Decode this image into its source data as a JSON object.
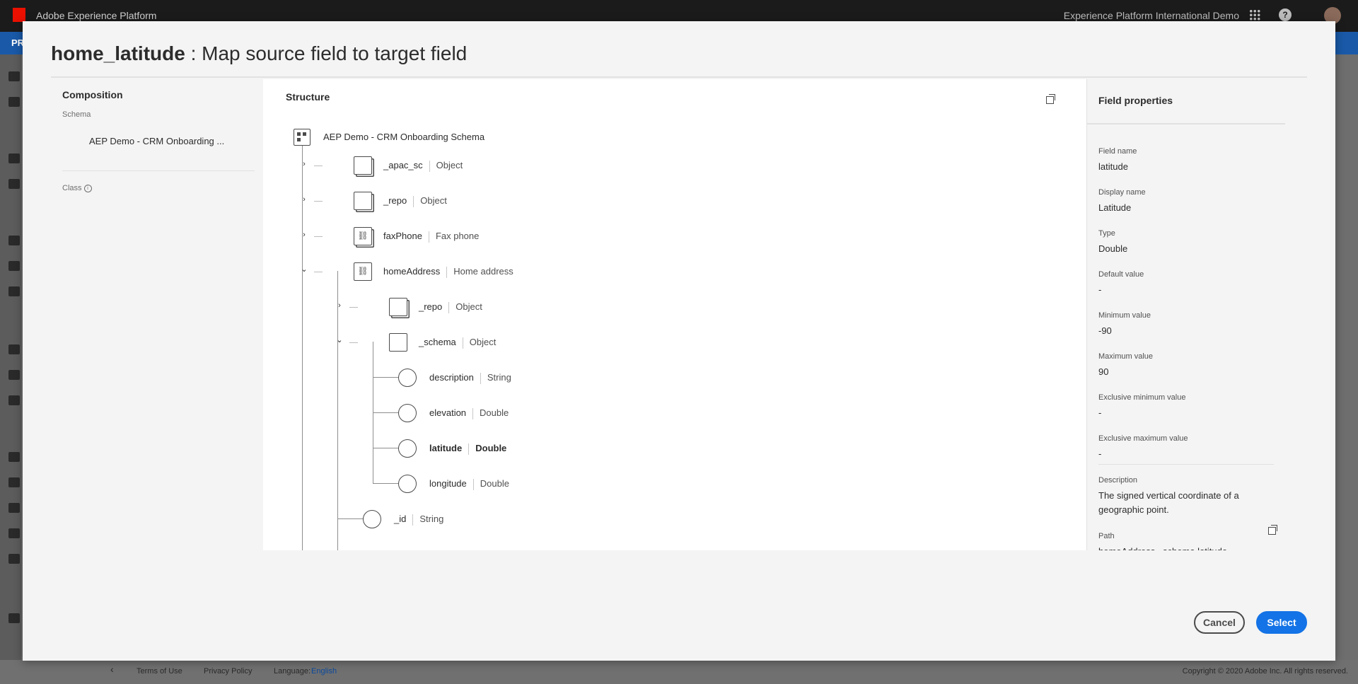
{
  "app": {
    "title": "Adobe Experience Platform",
    "org_name": "Experience Platform International Demo",
    "subnav_label": "PR"
  },
  "footer": {
    "terms": "Terms of Use",
    "privacy": "Privacy Policy",
    "language_label": "Language:",
    "language_value": "English",
    "copyright": "Copyright  ©  2020 Adobe Inc.  All rights reserved."
  },
  "modal": {
    "field_id": "home_latitude",
    "title_sep": " : ",
    "title_text": "Map source field to target field"
  },
  "composition": {
    "heading": "Composition",
    "schema_label": "Schema",
    "schema_name": "AEP Demo - CRM Onboarding ...",
    "class_label": "Class"
  },
  "structure": {
    "heading": "Structure",
    "root": "AEP Demo - CRM Onboarding Schema",
    "rows": [
      {
        "name": "_apac_sc",
        "type": "Object"
      },
      {
        "name": "_repo",
        "type": "Object"
      },
      {
        "name": "faxPhone",
        "type": "Fax phone"
      },
      {
        "name": "homeAddress",
        "type": "Home address"
      },
      {
        "name": "_repo",
        "type": "Object"
      },
      {
        "name": "_schema",
        "type": "Object"
      },
      {
        "name": "description",
        "type": "String"
      },
      {
        "name": "elevation",
        "type": "Double"
      },
      {
        "name": "latitude",
        "type": "Double"
      },
      {
        "name": "longitude",
        "type": "Double"
      },
      {
        "name": "_id",
        "type": "String"
      }
    ]
  },
  "field_properties": {
    "heading": "Field properties",
    "items": [
      {
        "label": "Field name",
        "value": "latitude"
      },
      {
        "label": "Display name",
        "value": "Latitude"
      },
      {
        "label": "Type",
        "value": "Double"
      },
      {
        "label": "Default value",
        "value": "-"
      },
      {
        "label": "Minimum value",
        "value": "-90"
      },
      {
        "label": "Maximum value",
        "value": "90"
      },
      {
        "label": "Exclusive minimum value",
        "value": "-"
      },
      {
        "label": "Exclusive maximum value",
        "value": "-"
      },
      {
        "label": "Description",
        "value": "The signed vertical coordinate of a geographic point."
      },
      {
        "label": "Path",
        "value": "homeAddress._schema.latitude"
      }
    ]
  },
  "buttons": {
    "cancel": "Cancel",
    "select": "Select"
  },
  "colors": {
    "accent": "#1473e6",
    "header": "#1b1b1b",
    "subnav": "#1a59a8",
    "adobe_red": "#eb1000"
  }
}
